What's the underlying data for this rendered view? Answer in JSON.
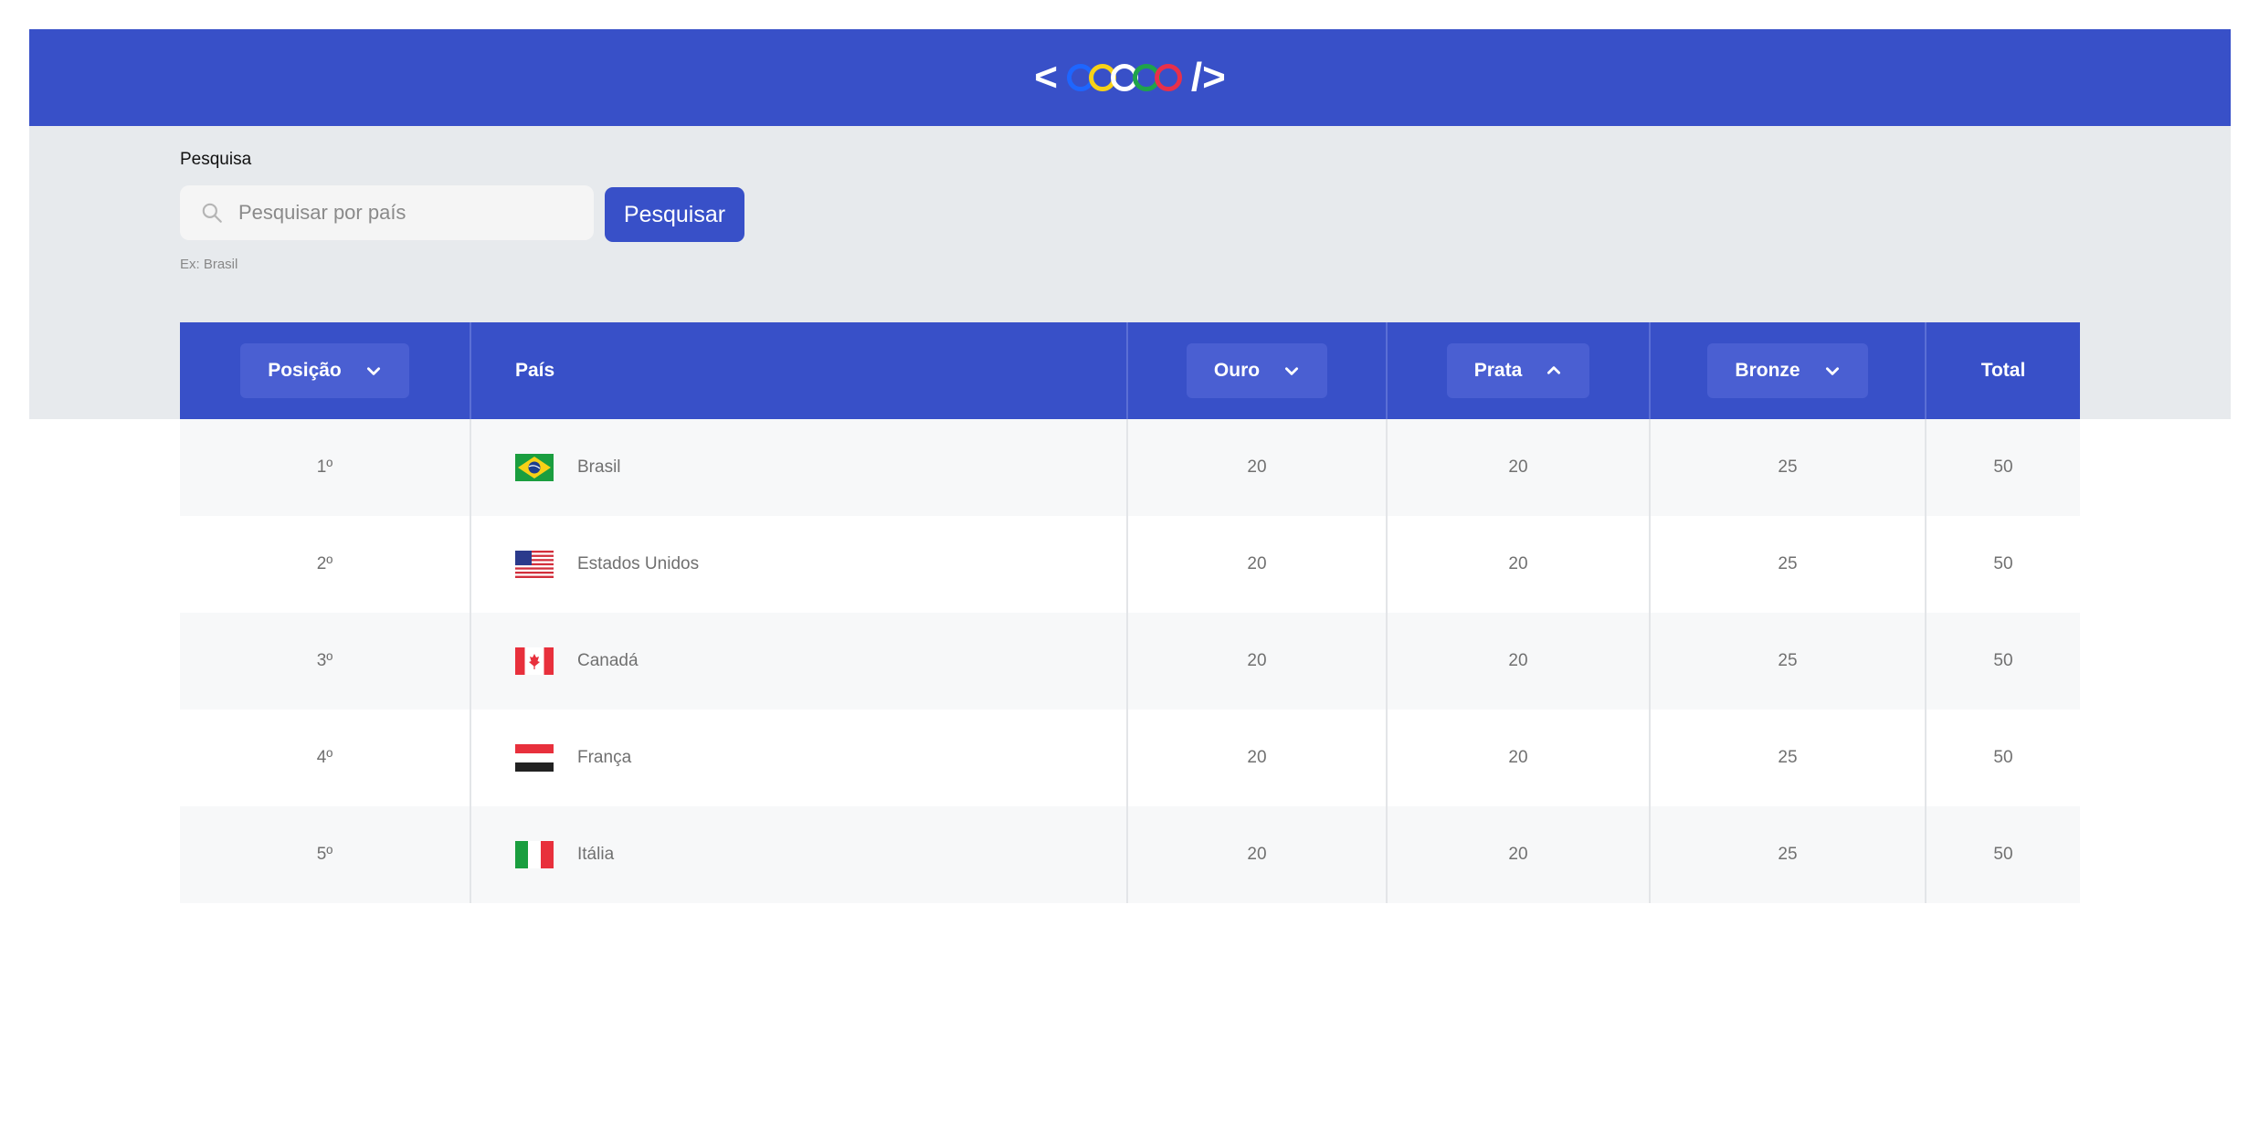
{
  "header": {
    "logo_left": "<",
    "logo_right": "/>",
    "ring_colors": [
      "#1E66FF",
      "#F7D117",
      "#FFFFFF",
      "#1FA34A",
      "#E8304A"
    ]
  },
  "search": {
    "label": "Pesquisa",
    "placeholder": "Pesquisar por país",
    "value": "",
    "button_label": "Pesquisar",
    "hint": "Ex: Brasil"
  },
  "table": {
    "columns": {
      "position": "Posição",
      "country": "País",
      "gold": "Ouro",
      "silver": "Prata",
      "bronze": "Bronze",
      "total": "Total"
    },
    "rows": [
      {
        "position": "1º",
        "country": "Brasil",
        "flag": "brazil-flag-icon",
        "gold": "20",
        "silver": "20",
        "bronze": "25",
        "total": "50"
      },
      {
        "position": "2º",
        "country": "Estados Unidos",
        "flag": "usa-flag-icon",
        "gold": "20",
        "silver": "20",
        "bronze": "25",
        "total": "50"
      },
      {
        "position": "3º",
        "country": "Canadá",
        "flag": "canada-flag-icon",
        "gold": "20",
        "silver": "20",
        "bronze": "25",
        "total": "50"
      },
      {
        "position": "4º",
        "country": "França",
        "flag": "france-flag-icon",
        "gold": "20",
        "silver": "20",
        "bronze": "25",
        "total": "50"
      },
      {
        "position": "5º",
        "country": "Itália",
        "flag": "italy-flag-icon",
        "gold": "20",
        "silver": "20",
        "bronze": "25",
        "total": "50"
      }
    ]
  },
  "colors": {
    "primary": "#3850C8",
    "band": "#E7EAED",
    "row_alt": "#F7F8F9"
  }
}
